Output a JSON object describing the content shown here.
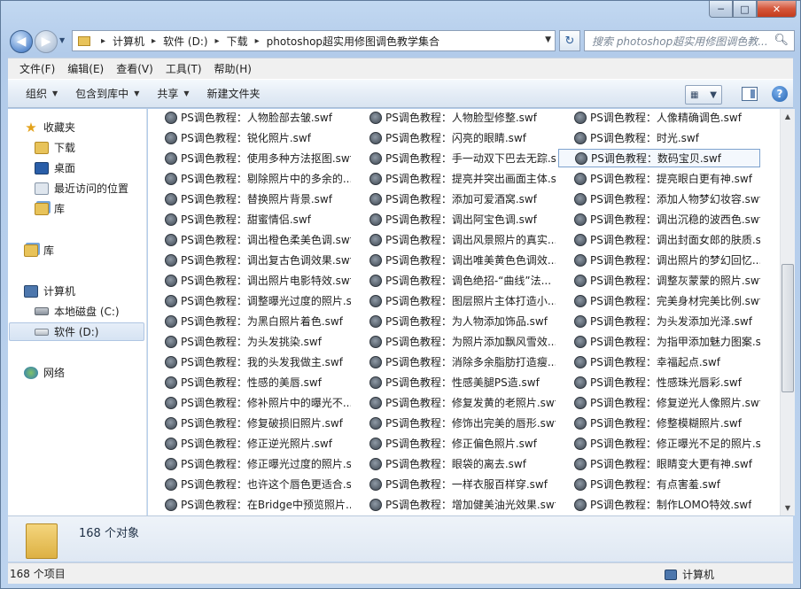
{
  "window": {
    "minimize": "─",
    "maximize": "□",
    "close": "✕"
  },
  "nav": {
    "back_arrow": "◀",
    "forward_arrow": "▶",
    "dropdown": "▼",
    "breadcrumb": [
      "计算机",
      "软件 (D:)",
      "下载",
      "photoshop超实用修图调色教学集合"
    ],
    "separator": "▸",
    "refresh_glyph": "↻",
    "search_placeholder": "搜索 photoshop超实用修图调色教..."
  },
  "menu": [
    "文件(F)",
    "编辑(E)",
    "查看(V)",
    "工具(T)",
    "帮助(H)"
  ],
  "commands": {
    "organize": "组织",
    "include_library": "包含到库中",
    "share": "共享",
    "new_folder": "新建文件夹",
    "help": "?"
  },
  "sidebar": {
    "favorites": "收藏夹",
    "downloads": "下载",
    "desktop": "桌面",
    "recent": "最近访问的位置",
    "library_fav": "库",
    "library": "库",
    "computer": "计算机",
    "drive_c": "本地磁盘 (C:)",
    "drive_d": "软件 (D:)",
    "network": "网络"
  },
  "files": {
    "col1": [
      "PS调色教程：人物脸部去皱.swf",
      "PS调色教程：锐化照片.swf",
      "PS调色教程：使用多种方法抠图.swf",
      "PS调色教程：剔除照片中的多余的...",
      "PS调色教程：替换照片背景.swf",
      "PS调色教程：甜蜜情侣.swf",
      "PS调色教程：调出橙色柔美色调.swf",
      "PS调色教程：调出复古色调效果.swf",
      "PS调色教程：调出照片电影特效.swf",
      "PS调色教程：调整曝光过度的照片.s...",
      "PS调色教程：为黑白照片着色.swf",
      "PS调色教程：为头发挑染.swf",
      "PS调色教程：我的头发我做主.swf",
      "PS调色教程：性感的美唇.swf",
      "PS调色教程：修补照片中的曝光不...",
      "PS调色教程：修复破损旧照片.swf",
      "PS调色教程：修正逆光照片.swf",
      "PS调色教程：修正曝光过度的照片.s...",
      "PS调色教程：也许这个唇色更适合.s...",
      "PS调色教程：在Bridge中预览照片...."
    ],
    "col2": [
      "PS调色教程：人物脸型修整.swf",
      "PS调色教程：闪亮的眼睛.swf",
      "PS调色教程：手一动双下巴去无踪.s...",
      "PS调色教程：提亮并突出画面主体.s...",
      "PS调色教程：添加可爱酒窝.swf",
      "PS调色教程：调出阿宝色调.swf",
      "PS调色教程：调出风景照片的真实...",
      "PS调色教程：调出唯美黄色色调效...",
      "PS调色教程：调色绝招-“曲线”法...",
      "PS调色教程：图层照片主体打造小...",
      "PS调色教程：为人物添加饰品.swf",
      "PS调色教程：为照片添加飘风雪效...",
      "PS调色教程：消除多余脂肪打造瘦...",
      "PS调色教程：性感美腿PS造.swf",
      "PS调色教程：修复发黄的老照片.swf",
      "PS调色教程：修饰出完美的唇形.swf",
      "PS调色教程：修正偏色照片.swf",
      "PS调色教程：眼袋的离去.swf",
      "PS调色教程：一样衣服百样穿.swf",
      "PS调色教程：增加健美油光效果.swf"
    ],
    "col3": [
      "PS调色教程：人像精确调色.swf",
      "PS调色教程：时光.swf",
      "PS调色教程：数码宝贝.swf",
      "PS调色教程：提亮眼白更有神.swf",
      "PS调色教程：添加人物梦幻妆容.swf",
      "PS调色教程：调出沉稳的波西色.swf",
      "PS调色教程：调出封面女郎的肤质.s...",
      "PS调色教程：调出照片的梦幻回忆...",
      "PS调色教程：调整灰蒙蒙的照片.swf",
      "PS调色教程：完美身材完美比例.swf",
      "PS调色教程：为头发添加光泽.swf",
      "PS调色教程：为指甲添加魅力图案.s...",
      "PS调色教程：幸福起点.swf",
      "PS调色教程：性感珠光唇彩.swf",
      "PS调色教程：修复逆光人像照片.swf",
      "PS调色教程：修整模糊照片.swf",
      "PS调色教程：修正曝光不足的照片.s...",
      "PS调色教程：眼睛变大更有神.swf",
      "PS调色教程：有点害羞.swf",
      "PS调色教程：制作LOMO特效.swf"
    ]
  },
  "scroll": {
    "up": "▲",
    "down": "▼"
  },
  "details": {
    "count": "168 个对象"
  },
  "status": {
    "count": "168 个项目",
    "location": "计算机"
  }
}
